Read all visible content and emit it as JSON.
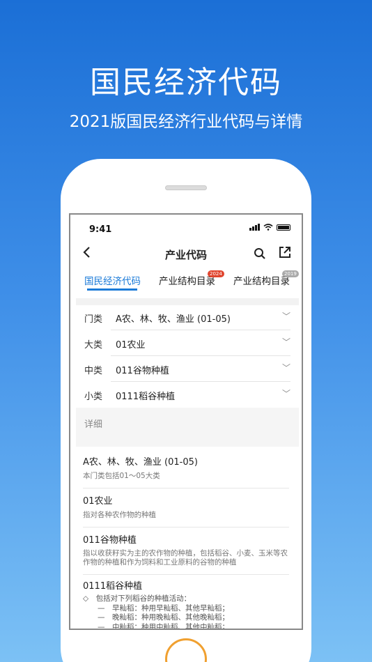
{
  "banner": {
    "title": "国民经济代码",
    "subtitle": "2021版国民经济行业代码与详情"
  },
  "status_bar": {
    "time": "9:41"
  },
  "nav": {
    "title": "产业代码",
    "back_icon": "chevron-left-icon",
    "search_icon": "search-icon",
    "share_icon": "share-icon"
  },
  "tabs": [
    {
      "label": "国民经济代码",
      "active": true
    },
    {
      "label": "产业结构目录",
      "badge": "2024",
      "badge_color": "#e0452e"
    },
    {
      "label": "产业结构目录",
      "badge": "2019",
      "badge_color": "#aaaaaa"
    }
  ],
  "selectors": [
    {
      "label": "门类",
      "value": "A农、林、牧、渔业 (01-05)"
    },
    {
      "label": "大类",
      "value": "01农业"
    },
    {
      "label": "中类",
      "value": "011谷物种植"
    },
    {
      "label": "小类",
      "value": "0111稻谷种植"
    }
  ],
  "detail_label": "详细",
  "details": [
    {
      "title": "A农、林、牧、渔业 (01-05)",
      "desc": "本门类包括01～05大类"
    },
    {
      "title": "01农业",
      "desc": "指对各种农作物的种植"
    },
    {
      "title": "011谷物种植",
      "desc": "指以收获籽实为主的农作物的种植，包括稻谷、小麦、玉米等农作物的种植和作为饲料和工业原料的谷物的种植"
    },
    {
      "title": "0111稻谷种植",
      "desc": ""
    }
  ],
  "sub_lines": [
    "◇　包括对下列稻谷的种植活动：",
    "　　—　早籼稻：种用早籼稻、其他早籼稻；",
    "　　—　晚籼稻：种用晚籼稻、其他晚籼稻；",
    "　　—　中籼稻：种用中籼稻、其他中籼稻；"
  ]
}
